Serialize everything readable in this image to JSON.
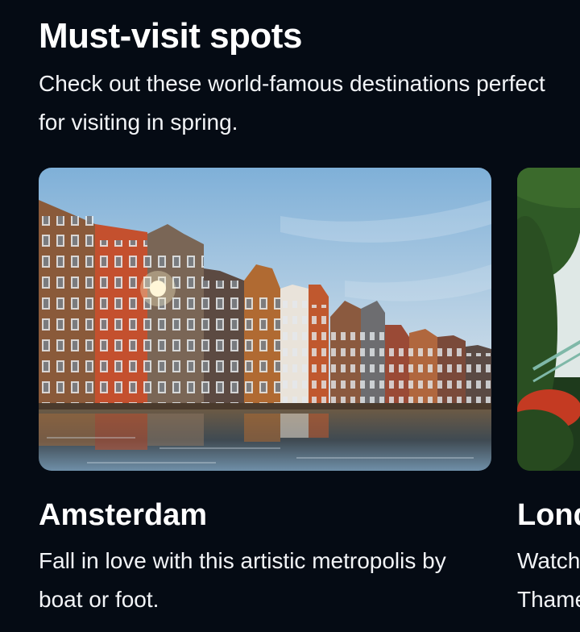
{
  "section": {
    "title": "Must-visit spots",
    "subtitle": "Check out these world-famous destinations perfect for visiting in spring."
  },
  "destinations": [
    {
      "name": "Amsterdam",
      "description": "Fall in love with this artistic metropolis by boat or foot.",
      "image": "amsterdam-canal-houses-photo"
    },
    {
      "name": "London",
      "description": "Watch the world go by from the banks of the Thames.",
      "image": "london-greenery-bridge-photo"
    }
  ],
  "colors": {
    "background": "#050b14",
    "text": "#ffffff"
  }
}
